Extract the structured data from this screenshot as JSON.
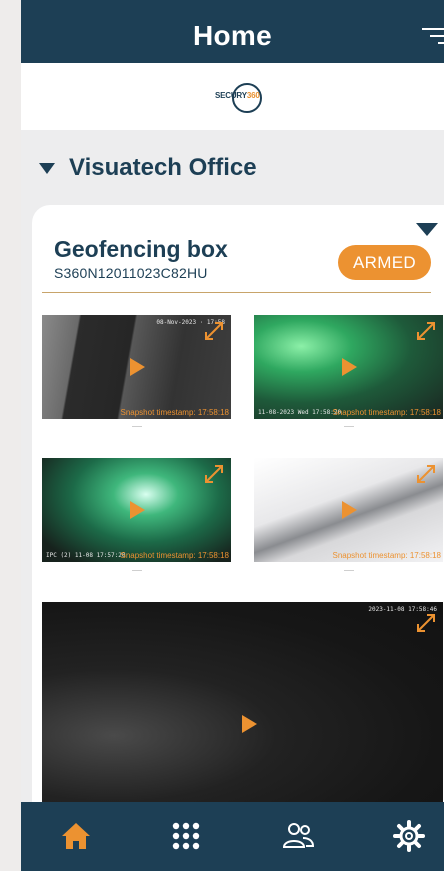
{
  "header": {
    "title": "Home",
    "filter_icon": "filter-icon"
  },
  "logo": {
    "word_main": "SECURY",
    "word_accent": "360"
  },
  "group": {
    "name": "Visuatech Office"
  },
  "device": {
    "name": "Geofencing box",
    "serial": "S360N12011023C82HU",
    "status": "ARMED"
  },
  "cameras": [
    {
      "osd_top": "08-Nov-2023 · 17:58",
      "osd_bottom": "",
      "snapshot": "Snapshot timestamp: 17:58:18"
    },
    {
      "osd_top": "",
      "osd_bottom": "11-08-2023 Wed 17:58:20",
      "snapshot": "Snapshot timestamp: 17:58:18"
    },
    {
      "osd_top": "",
      "osd_bottom": "IPC (2) 11-08 17:57:20",
      "snapshot": "Snapshot timestamp: 17:58:18"
    },
    {
      "osd_top": "",
      "osd_bottom": "",
      "snapshot": "Snapshot timestamp: 17:58:18"
    },
    {
      "osd_top": "2023-11-08 17:58:46",
      "osd_bottom": "",
      "snapshot": ""
    }
  ],
  "nav": [
    "home-icon",
    "grid-icon",
    "users-icon",
    "gear-icon"
  ],
  "colors": {
    "primary": "#1d3f55",
    "accent": "#ec9231"
  }
}
